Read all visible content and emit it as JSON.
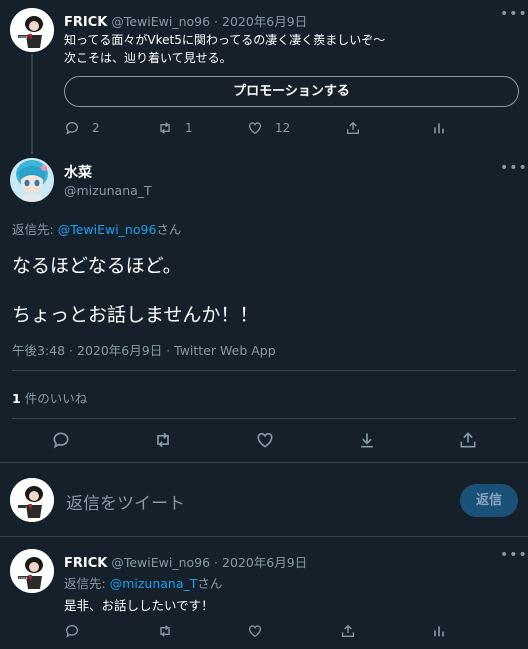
{
  "prev_tweet": {
    "display_name": "FRICK",
    "handle": "@TewiEwi_no96",
    "separator": "·",
    "date": "2020年6月9日",
    "text_line1": "知ってる面々がVket5に関わってるの凄く凄く羨ましいぞ〜",
    "text_line2": "次こそは、辿り着いて見せる。",
    "promote_label": "プロモーションする",
    "reply_count": "2",
    "retweet_count": "1",
    "like_count": "12"
  },
  "main_tweet": {
    "display_name": "水菜",
    "handle": "@mizunana_T",
    "reply_to_prefix": "返信先: ",
    "reply_to_handle": "@TewiEwi_no96",
    "reply_to_suffix": "さん",
    "text_line1": "なるほどなるほど。",
    "text_line2": "ちょっとお話しませんか！！",
    "meta": "午後3:48 · 2020年6月9日 · Twitter Web App",
    "likes_count": "1",
    "likes_label": "件のいいね"
  },
  "compose": {
    "placeholder": "返信をツイート",
    "reply_button": "返信"
  },
  "reply_tweet": {
    "display_name": "FRICK",
    "handle": "@TewiEwi_no96",
    "separator": "·",
    "date": "2020年6月9日",
    "reply_to_prefix": "返信先: ",
    "reply_to_handle": "@mizunana_T",
    "reply_to_suffix": "さん",
    "text": "是非、お話ししたいです！"
  },
  "icons": {
    "more": "more-horizontal-icon",
    "reply": "reply-icon",
    "retweet": "retweet-icon",
    "like": "like-icon",
    "share": "share-icon",
    "analytics": "analytics-icon",
    "bookmark": "bookmark-icon"
  },
  "colors": {
    "background": "#15202b",
    "text": "#ffffff",
    "muted": "#8899a6",
    "link": "#1da1f2",
    "divider": "#38444d",
    "reply_button_bg": "#1a5178"
  }
}
